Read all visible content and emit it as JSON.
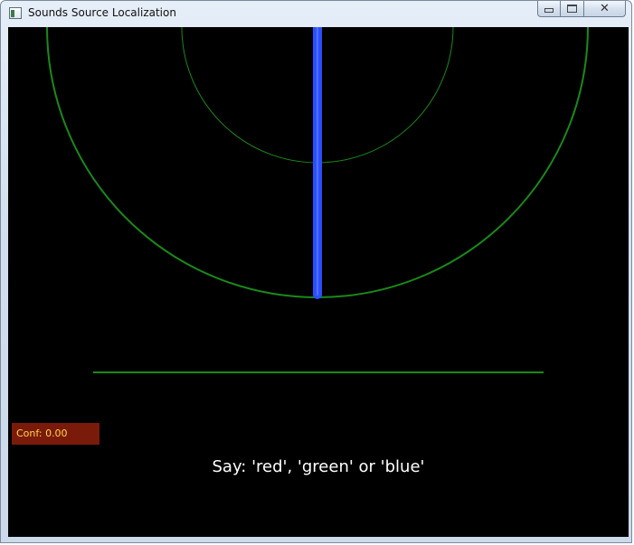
{
  "window": {
    "title": "Sounds Source Localization",
    "icon": "app-window-icon",
    "caption_buttons": {
      "minimize_icon": "minimize-icon",
      "maximize_icon": "restore-icon",
      "close_icon": "close-icon"
    }
  },
  "visualization": {
    "background_color": "#000000",
    "ring_color": "#1a8a1a",
    "beam_color": "#2a4fff",
    "baseline_color": "#1a8a1a"
  },
  "status": {
    "confidence_label": "Conf: 0.00",
    "confidence_value": 0.0,
    "confidence_bg": "#7a1a0a",
    "confidence_text_color": "#ffd54a"
  },
  "prompt": {
    "text": "Say: 'red', 'green' or 'blue'"
  }
}
